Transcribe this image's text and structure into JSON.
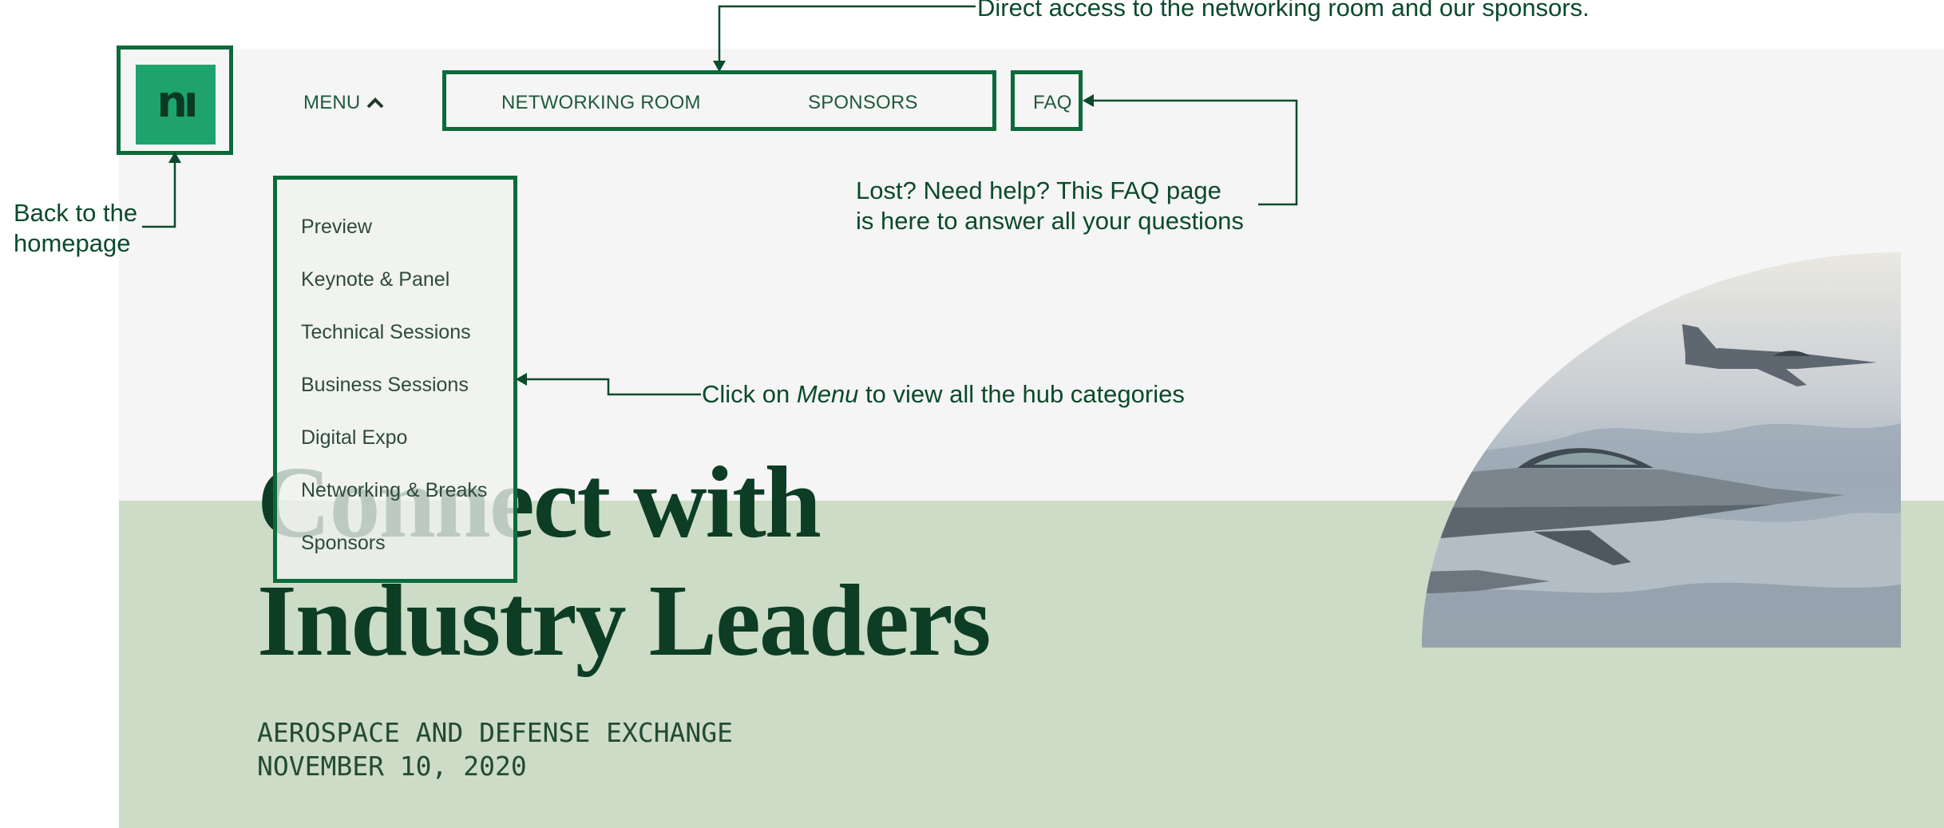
{
  "nav": {
    "logo_text": "nı",
    "menu_label": "MENU",
    "networking_room": "NETWORKING ROOM",
    "sponsors": "SPONSORS",
    "faq": "FAQ"
  },
  "menu_items": [
    "Preview",
    "Keynote & Panel",
    "Technical Sessions",
    "Business Sessions",
    "Digital Expo",
    "Networking & Breaks",
    "Sponsors"
  ],
  "hero": {
    "title_line1": "Connect with",
    "title_line2": "Industry Leaders",
    "event_name": "AEROSPACE AND DEFENSE EXCHANGE",
    "event_date": "NOVEMBER 10, 2020"
  },
  "annotations": {
    "top": "Direct access to the networking room and our sponsors.",
    "faq_line1": "Lost? Need help? This FAQ page",
    "faq_line2": "is here to answer all your questions",
    "home_line1": "Back to the",
    "home_line2": "homepage",
    "menu_pre": "Click on ",
    "menu_em": "Menu",
    "menu_post": " to view all the hub categories"
  },
  "colors": {
    "brand_green": "#1ea36d",
    "annotation_green": "#0b6b3a",
    "hero_background": "#cddcc6",
    "title_color": "#0d3d25"
  }
}
